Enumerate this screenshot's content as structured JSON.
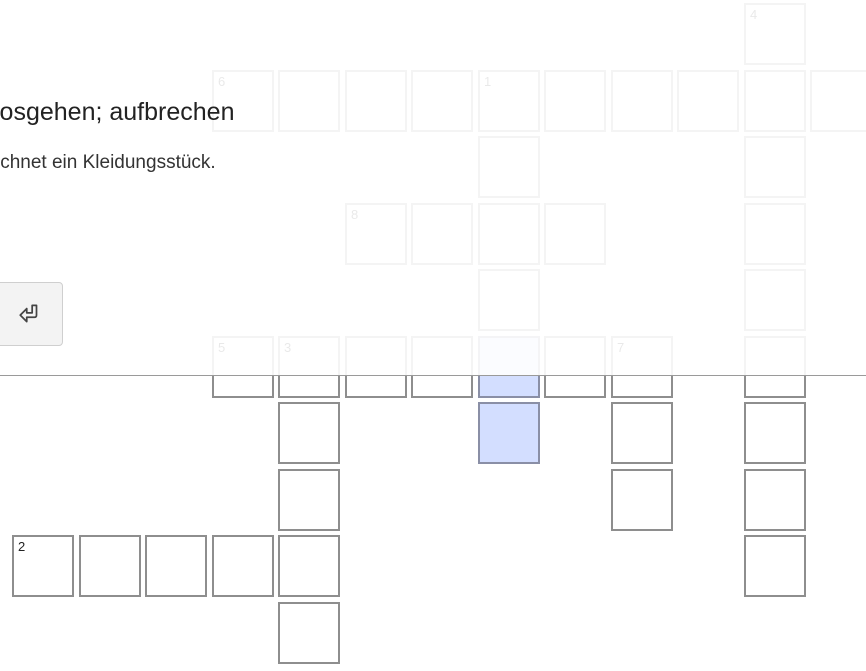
{
  "clue": {
    "title": "losgehen; aufbrechen",
    "text": "ichnet ein Kleidungsstück."
  },
  "submit": {
    "icon": "enter-icon"
  },
  "colors": {
    "active_cell": "#d3deff",
    "cell_border": "#8e8e8e",
    "overlay": "rgba(255,255,255,0.90)"
  },
  "grid": {
    "cells": [
      {
        "c": 11,
        "r": 0,
        "num": "4"
      },
      {
        "c": 3,
        "r": 1,
        "num": "6"
      },
      {
        "c": 4,
        "r": 1
      },
      {
        "c": 5,
        "r": 1
      },
      {
        "c": 6,
        "r": 1
      },
      {
        "c": 7,
        "r": 1,
        "num": "1"
      },
      {
        "c": 8,
        "r": 1
      },
      {
        "c": 9,
        "r": 1
      },
      {
        "c": 10,
        "r": 1
      },
      {
        "c": 11,
        "r": 1
      },
      {
        "c": 12,
        "r": 1
      },
      {
        "c": 7,
        "r": 2
      },
      {
        "c": 11,
        "r": 2
      },
      {
        "c": 5,
        "r": 3,
        "num": "8"
      },
      {
        "c": 6,
        "r": 3
      },
      {
        "c": 7,
        "r": 3
      },
      {
        "c": 8,
        "r": 3
      },
      {
        "c": 11,
        "r": 3
      },
      {
        "c": 7,
        "r": 4
      },
      {
        "c": 11,
        "r": 4
      },
      {
        "c": 3,
        "r": 5,
        "num": "5"
      },
      {
        "c": 4,
        "r": 5,
        "num": "3"
      },
      {
        "c": 5,
        "r": 5
      },
      {
        "c": 6,
        "r": 5
      },
      {
        "c": 7,
        "r": 5,
        "active": true
      },
      {
        "c": 8,
        "r": 5
      },
      {
        "c": 9,
        "r": 5,
        "num": "7"
      },
      {
        "c": 11,
        "r": 5
      },
      {
        "c": 4,
        "r": 6
      },
      {
        "c": 7,
        "r": 6,
        "active": true
      },
      {
        "c": 9,
        "r": 6
      },
      {
        "c": 11,
        "r": 6
      },
      {
        "c": 4,
        "r": 7
      },
      {
        "c": 9,
        "r": 7
      },
      {
        "c": 11,
        "r": 7
      },
      {
        "c": 0,
        "r": 8,
        "num": "2"
      },
      {
        "c": 1,
        "r": 8
      },
      {
        "c": 2,
        "r": 8
      },
      {
        "c": 3,
        "r": 8
      },
      {
        "c": 4,
        "r": 8
      },
      {
        "c": 11,
        "r": 8
      },
      {
        "c": 4,
        "r": 9
      }
    ]
  }
}
